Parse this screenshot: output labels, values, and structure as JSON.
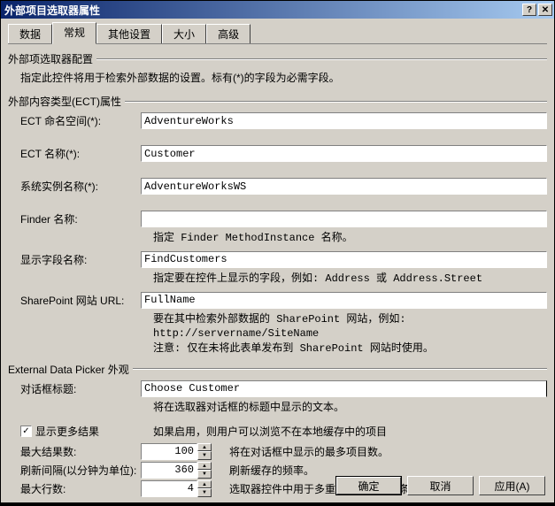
{
  "window": {
    "title": "外部项目选取器属性"
  },
  "tabs": [
    "数据",
    "常规",
    "其他设置",
    "大小",
    "高级"
  ],
  "active_tab": 1,
  "section1": {
    "title": "外部项选取器配置",
    "desc": "指定此控件将用于检索外部数据的设置。标有(*)的字段为必需字段。"
  },
  "section2": {
    "title": "外部内容类型(ECT)属性",
    "fields": {
      "ect_ns": {
        "label": "ECT 命名空间(*):",
        "value": "AdventureWorks"
      },
      "ect_name": {
        "label": "ECT 名称(*):",
        "value": "Customer"
      },
      "sys_inst": {
        "label": "系统实例名称(*):",
        "value": "AdventureWorksWS"
      },
      "finder": {
        "label": "Finder 名称:",
        "value": "",
        "hint": "指定 Finder MethodInstance 名称。"
      },
      "disp_field": {
        "label": "显示字段名称:",
        "value": "FindCustomers",
        "hint": "指定要在控件上显示的字段，例如: Address 或 Address.Street"
      },
      "sp_url": {
        "label": "SharePoint 网站 URL:",
        "value": "FullName",
        "hint": "要在其中检索外部数据的 SharePoint 网站，例如: http://servername/SiteName\n注意: 仅在未将此表单发布到 SharePoint 网站时使用。"
      }
    }
  },
  "section3": {
    "title": "External Data Picker 外观",
    "dialog_title": {
      "label": "对话框标题:",
      "value": "Choose Customer",
      "hint": "将在选取器对话框的标题中显示的文本。"
    },
    "show_more": {
      "label": "显示更多结果",
      "checked": true,
      "hint": "如果启用，则用户可以浏览不在本地缓存中的项目"
    },
    "max_results": {
      "label": "最大结果数:",
      "value": "100",
      "desc": "将在对话框中显示的最多项目数。"
    },
    "refresh": {
      "label": "刷新间隔(以分钟为单位):",
      "value": "360",
      "desc": "刷新缓存的频率。"
    },
    "max_rows": {
      "label": "最大行数:",
      "value": "4",
      "desc": "选取器控件中用于多重选择的可见线条。"
    }
  },
  "buttons": {
    "ok": "确定",
    "cancel": "取消",
    "apply": "应用(A)"
  }
}
